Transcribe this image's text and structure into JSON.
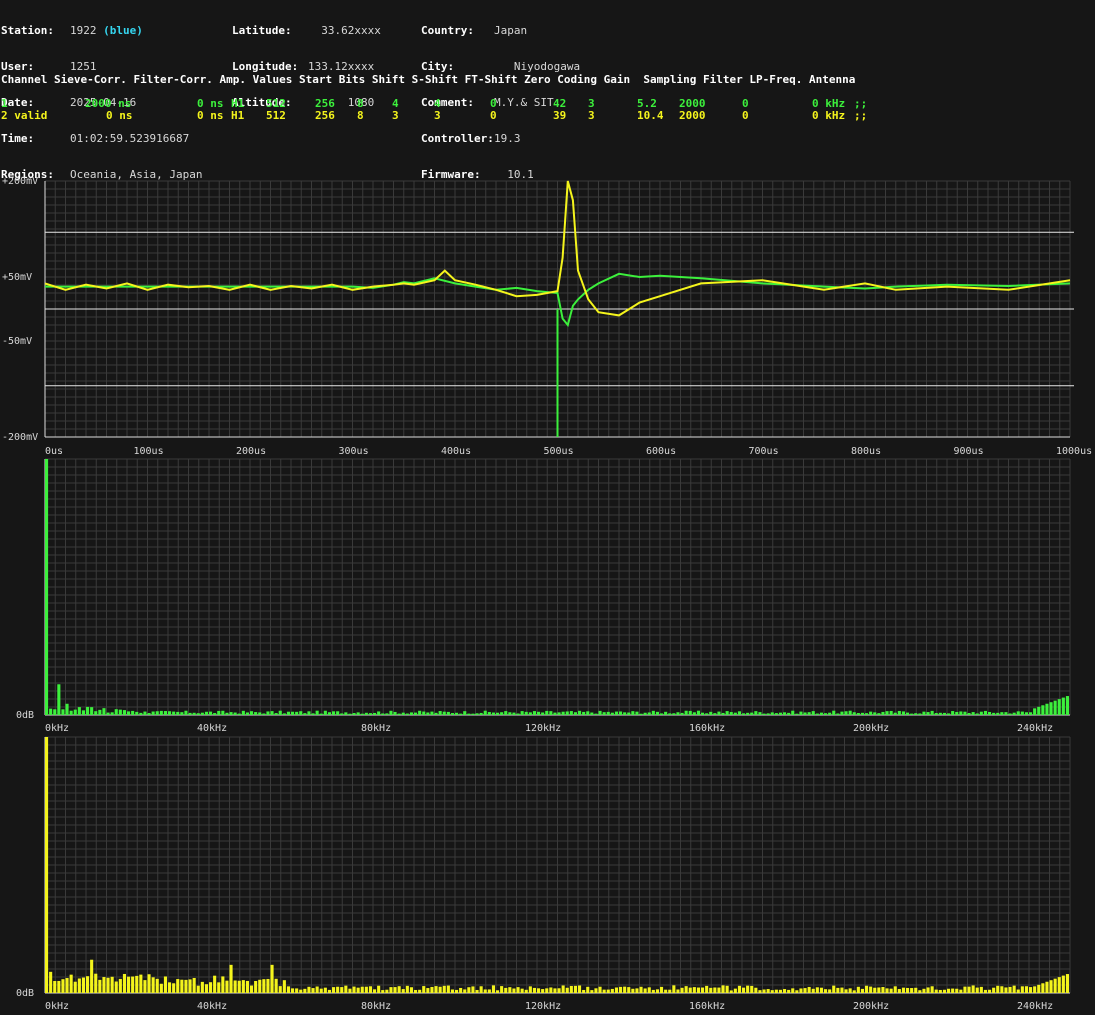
{
  "station": {
    "station_label": "Station:",
    "station_value": "1922",
    "station_color_note": "(blue)",
    "user_label": "User:",
    "user_value": "1251",
    "date_label": "Date:",
    "date_value": "2025-04-16",
    "time_label": "Time:",
    "time_value": "01:02:59.523916687",
    "regions_label": "Regions:",
    "regions_value": "Oceania, Asia, Japan"
  },
  "location": {
    "lat_label": "Latitude:",
    "lat_value": "  33.62xxxx",
    "lon_label": "Longitude:",
    "lon_value": "133.12xxxx",
    "alt_label": "Altitude:",
    "alt_value": "      1080"
  },
  "meta": {
    "country_label": "Country:",
    "country_value": "Japan",
    "city_label": "City:",
    "city_value": "   Niyodogawa",
    "comment_label": "Comment:",
    "comment_value": "M.Y.& SIT",
    "controller_label": "Controller:",
    "controller_value": "19.3",
    "firmware_label": "Firmware:",
    "firmware_value": "  10.1"
  },
  "channel_header": "Channel Sieve-Corr. Filter-Corr. Amp. Values Start Bits Shift S-Shift FT-Shift Zero Coding Gain  Sampling Filter LP-Freq. Antenna",
  "channels": [
    {
      "channel": "1",
      "sieve": "2000 ns",
      "filter": "0 ns",
      "amp": "H1",
      "values": "512",
      "start": "256",
      "bits": "8",
      "shift": "4",
      "sshift": "4",
      "ftshift": "0",
      "zero": "42",
      "coding": "3",
      "gain": "5.2",
      "sampling": "2000",
      "filt": "0",
      "lpfreq": "0 kHz",
      "antenna": ";;"
    },
    {
      "channel": "2 valid",
      "sieve": "0 ns",
      "filter": "0 ns",
      "amp": "H1",
      "values": "512",
      "start": "256",
      "bits": "8",
      "shift": "3",
      "sshift": "3",
      "ftshift": "0",
      "zero": "39",
      "coding": "3",
      "gain": "10.4",
      "sampling": "2000",
      "filt": "0",
      "lpfreq": "0 kHz",
      "antenna": ";;"
    }
  ],
  "colors": {
    "ch1": "#3cf03c",
    "ch2": "#f4f41c",
    "background": "#161616",
    "grid": "#444444",
    "station": "#35d6f0"
  },
  "chart_data": [
    {
      "type": "line",
      "xlim": [
        0,
        1000
      ],
      "ylim": [
        -200,
        200
      ],
      "x_ticks": [
        "0us",
        "100us",
        "200us",
        "300us",
        "400us",
        "500us",
        "600us",
        "700us",
        "800us",
        "900us",
        "1000us"
      ],
      "y_ticks": [
        "+200mV",
        "+50mV",
        "-50mV",
        "-200mV"
      ],
      "reference_lines_mV": [
        0,
        120,
        -120
      ],
      "series": [
        {
          "x": [
            0,
            20,
            40,
            60,
            80,
            100,
            120,
            140,
            160,
            180,
            200,
            220,
            240,
            260,
            280,
            300,
            320,
            340,
            350,
            360,
            380,
            400,
            420,
            440,
            460,
            480,
            500,
            505,
            510,
            515,
            520,
            530,
            540,
            560,
            580,
            600,
            640,
            700,
            760,
            800,
            830,
            880,
            940,
            1000
          ],
          "y": [
            35,
            35,
            35,
            35,
            35,
            35,
            35,
            35,
            35,
            35,
            35,
            35,
            35,
            35,
            35,
            35,
            33,
            38,
            42,
            40,
            48,
            40,
            35,
            30,
            33,
            28,
            25,
            -15,
            -25,
            5,
            15,
            30,
            40,
            55,
            50,
            52,
            48,
            40,
            35,
            32,
            35,
            38,
            36,
            40
          ]
        },
        {
          "x": [
            0,
            20,
            40,
            60,
            80,
            100,
            120,
            140,
            160,
            180,
            200,
            220,
            240,
            260,
            280,
            300,
            320,
            340,
            350,
            360,
            380,
            390,
            400,
            420,
            440,
            460,
            480,
            500,
            505,
            510,
            515,
            520,
            530,
            540,
            560,
            580,
            600,
            640,
            700,
            760,
            800,
            830,
            880,
            940,
            1000
          ],
          "y": [
            40,
            30,
            38,
            32,
            40,
            30,
            38,
            34,
            36,
            30,
            38,
            30,
            36,
            32,
            38,
            30,
            35,
            38,
            40,
            38,
            45,
            60,
            45,
            38,
            30,
            20,
            22,
            28,
            80,
            200,
            170,
            60,
            15,
            -5,
            -10,
            10,
            20,
            40,
            45,
            30,
            40,
            30,
            35,
            30,
            45
          ]
        }
      ]
    },
    {
      "type": "bar",
      "x_ticks": [
        "0kHz",
        "40kHz",
        "80kHz",
        "120kHz",
        "160kHz",
        "200kHz",
        "240kHz"
      ],
      "y_ticks": [
        "0dB"
      ],
      "xlim": [
        0,
        250
      ],
      "peaks": [
        {
          "x": 0,
          "y": 1.0
        },
        {
          "x": 3,
          "y": 0.12
        },
        {
          "x": 250,
          "y": 0.08
        }
      ]
    },
    {
      "type": "bar",
      "x_ticks": [
        "0kHz",
        "40kHz",
        "80kHz",
        "120kHz",
        "160kHz",
        "200kHz",
        "240kHz"
      ],
      "y_ticks": [
        "0dB"
      ],
      "xlim": [
        0,
        250
      ],
      "peaks": [
        {
          "x": 0,
          "y": 1.0
        },
        {
          "x": 11,
          "y": 0.13
        },
        {
          "x": 45,
          "y": 0.11
        },
        {
          "x": 55,
          "y": 0.11
        },
        {
          "x": 250,
          "y": 0.07
        }
      ]
    }
  ]
}
